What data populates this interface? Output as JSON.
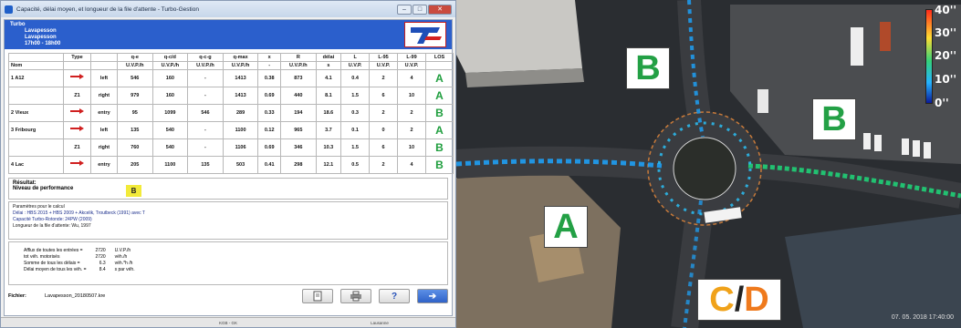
{
  "window": {
    "title": "Capacité, délai moyen, et longueur de la file d'attente - Turbo-Gestion"
  },
  "header": {
    "line1": "Turbo",
    "line2": "Lavapesson",
    "line3": "Lavapesson",
    "line4": "17h00 - 18h00"
  },
  "table": {
    "columns": [
      "",
      "Type",
      "",
      "q-e",
      "q-c/d",
      "q-c-g",
      "q-max",
      "x",
      "R",
      "délai",
      "L",
      "L-95",
      "L-99",
      "LOS"
    ],
    "units": [
      "Nom",
      "",
      "",
      "U.V.P./h",
      "U.V.P./h",
      "U.V.P./h",
      "U.V.P./h",
      "-",
      "U.V.P./h",
      "s",
      "U.V.P.",
      "U.V.P.",
      "U.V.P.",
      ""
    ],
    "rows": [
      {
        "no": "1",
        "name": "A12",
        "type": "",
        "dir": "left",
        "qe": "546",
        "qcd": "160",
        "qcg": "-",
        "qmax": "1413",
        "x": "0.38",
        "r": "873",
        "delai": "4.1",
        "l": "0.4",
        "l95": "2",
        "l99": "4",
        "los": "A"
      },
      {
        "no": "",
        "name": "",
        "type": "Z1",
        "dir": "right",
        "qe": "979",
        "qcd": "160",
        "qcg": "-",
        "qmax": "1413",
        "x": "0.69",
        "r": "440",
        "delai": "8.1",
        "l": "1.5",
        "l95": "6",
        "l99": "10",
        "los": "A"
      },
      {
        "no": "2",
        "name": "Vieux",
        "type": "",
        "dir": "entry",
        "qe": "95",
        "qcd": "1099",
        "qcg": "546",
        "qmax": "289",
        "x": "0.33",
        "r": "194",
        "delai": "18.6",
        "l": "0.3",
        "l95": "2",
        "l99": "2",
        "los": "B"
      },
      {
        "no": "3",
        "name": "Fribourg",
        "type": "",
        "dir": "left",
        "qe": "135",
        "qcd": "540",
        "qcg": "-",
        "qmax": "1100",
        "x": "0.12",
        "r": "965",
        "delai": "3.7",
        "l": "0.1",
        "l95": "0",
        "l99": "2",
        "los": "A"
      },
      {
        "no": "",
        "name": "",
        "type": "Z1",
        "dir": "right",
        "qe": "760",
        "qcd": "540",
        "qcg": "-",
        "qmax": "1106",
        "x": "0.69",
        "r": "346",
        "delai": "10.3",
        "l": "1.5",
        "l95": "6",
        "l99": "10",
        "los": "B"
      },
      {
        "no": "4",
        "name": "Lac",
        "type": "",
        "dir": "entry",
        "qe": "205",
        "qcd": "1100",
        "qcg": "135",
        "qmax": "503",
        "x": "0.41",
        "r": "298",
        "delai": "12.1",
        "l": "0.5",
        "l95": "2",
        "l99": "4",
        "los": "B"
      }
    ]
  },
  "result": {
    "heading": "Résultat:",
    "label": "Niveau de performance",
    "value": "B"
  },
  "params": {
    "heading": "Paramètres pour le calcul",
    "line1": "Délai                    : HBS 2015 + HBS 2009 + Akcelik, Troutbeck (1991)        avec T",
    "line2": "Capacité    Turbo-Rotonde: 24PW (2009)",
    "line3": "Longueur de la file d'attente: Wu, 1997"
  },
  "summary": {
    "labels": [
      "Afflux de toutes les entrées =",
      "   tot véh. motorisés",
      "Somme de tous les délais =",
      "Délai moyen de tous les véh. ="
    ],
    "values": [
      "2720",
      "2720",
      "6.3",
      "8.4"
    ],
    "units": [
      "U.V.P./h",
      "véh./h",
      "véh.*h /h",
      "s par véh."
    ]
  },
  "file": {
    "label": "Fichier:",
    "name": "Lavapesson_20180507.kre"
  },
  "status": {
    "left": "",
    "middle1": "KGB - GK",
    "middle2": "Lausanne"
  },
  "aerial": {
    "los_labels": [
      "B",
      "B",
      "A"
    ],
    "cd_c": "C",
    "cd_slash": "/",
    "cd_d": "D",
    "scale_labels": [
      "40''",
      "30''",
      "20''",
      "10''",
      "0''"
    ],
    "timestamp": "07. 05. 2018 17:40:00",
    "colors": {
      "los_green": "#23a045",
      "c_orange": "#f0a21a",
      "d_orange": "#ef7a1d"
    }
  }
}
